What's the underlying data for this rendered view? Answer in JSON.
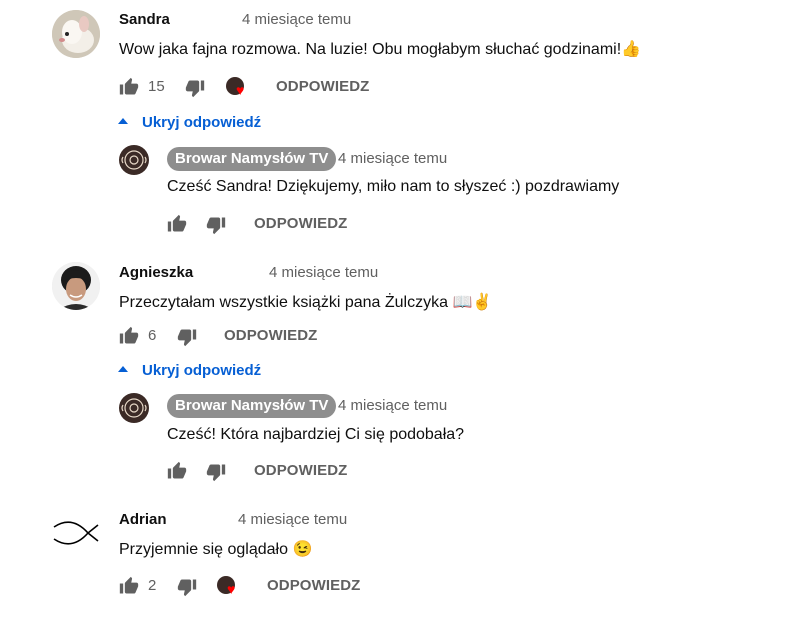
{
  "comments": [
    {
      "author": "Sandra",
      "time": "4 miesiące temu",
      "text": "Wow jaka fajna rozmowa. Na luzie! Obu mogłabym słuchać godzinami!",
      "emoji": "👍",
      "likes": "15",
      "reply_label": "ODPOWIEDZ",
      "toggle_label": "Ukryj odpowiedź",
      "reply": {
        "author": "Browar Namysłów TV",
        "time": "4 miesiące temu",
        "text": "Cześć Sandra! Dziękujemy, miło nam to słyszeć :) pozdrawiamy",
        "reply_label": "ODPOWIEDZ"
      }
    },
    {
      "author": "Agnieszka",
      "time": "4 miesiące temu",
      "text": "Przeczytałam wszystkie książki pana Żulczyka",
      "emoji": "📖✌️",
      "likes": "6",
      "reply_label": "ODPOWIEDZ",
      "toggle_label": "Ukryj odpowiedź",
      "reply": {
        "author": "Browar Namysłów TV",
        "time": "4 miesiące temu",
        "text": "Cześć! Która najbardziej Ci się podobała?",
        "reply_label": "ODPOWIEDZ"
      }
    },
    {
      "author": "Adrian",
      "time": "4 miesiące temu",
      "text": "Przyjemnie się oglądało",
      "emoji": "😉",
      "likes": "2",
      "reply_label": "ODPOWIEDZ"
    }
  ],
  "colors": {
    "link": "#065fd4",
    "secondary": "#606060",
    "heart": "#ff0000",
    "channel_chip": "#8e8e8e"
  }
}
